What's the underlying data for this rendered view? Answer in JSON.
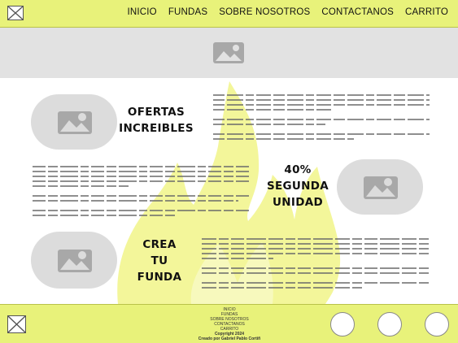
{
  "nav": {
    "items": [
      "INICIO",
      "FUNDAS",
      "SOBRE NOSOTROS",
      "CONTACTANOS",
      "CARRITO"
    ]
  },
  "sections": {
    "ofertas": "OFERTAS\nINCREIBLES",
    "segunda": "40%\nSEGUNDA\nUNIDAD",
    "crea": "CREA\nTU\nFUNDA"
  },
  "footer": {
    "links": [
      "INICIO",
      "FUNDAS",
      "SOBRE NOSOTROS",
      "CONTACTANOS",
      "CARRITO"
    ],
    "copyright": "Copyright 2024",
    "credit": "Creado por Gabriel Pablo Cortiñ"
  },
  "colors": {
    "accent": "#e8f27a",
    "flame": "#f3f69a",
    "placeholder": "#dcdcdc",
    "icon": "#a8a8a8"
  },
  "icons": {
    "logo": "x-box-icon",
    "image": "image-placeholder-icon",
    "social": "circle-icon"
  }
}
